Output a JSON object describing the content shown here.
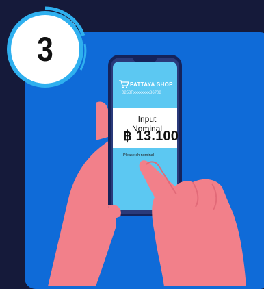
{
  "step": {
    "number": "3"
  },
  "phone": {
    "shop_name": "PATTAYA SHOP",
    "shop_phone": "0258Fxxxxxxxx86708",
    "input_label": "Input Nominal",
    "nominal_value": "฿ 13.100",
    "hint": "Please ch        nominal"
  },
  "colors": {
    "background": "#151a3a",
    "card": "#0f6bd8",
    "badge_ring": "#2fb0ef",
    "screen": "#5cc8f2",
    "hand": "#f2808a"
  },
  "icons": [
    "cart-icon"
  ]
}
